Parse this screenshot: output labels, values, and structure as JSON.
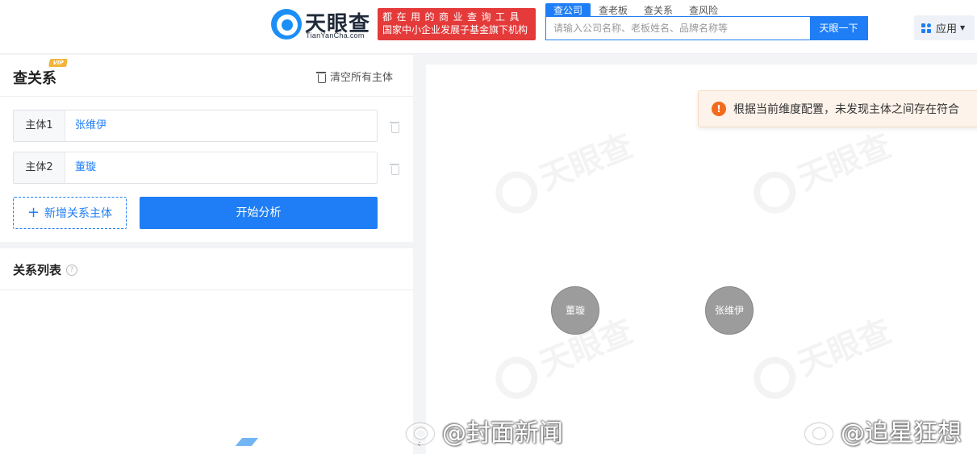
{
  "header": {
    "logo_text": "天眼查",
    "logo_sub": "TianYanCha.com",
    "slogan_line1": "都在用的商业查询工具",
    "slogan_line2": "国家中小企业发展子基金旗下机构",
    "search_tabs": [
      {
        "label": "查公司",
        "active": true
      },
      {
        "label": "查老板",
        "active": false
      },
      {
        "label": "查关系",
        "active": false
      },
      {
        "label": "查风险",
        "active": false
      }
    ],
    "search_placeholder": "请输入公司名称、老板姓名、品牌名称等",
    "search_button": "天眼一下",
    "apps_label": "应用",
    "accent_color": "#1f7ef5",
    "slogan_color": "#e43a3a"
  },
  "left_panel": {
    "title": "查关系",
    "vip_badge": "VIP",
    "clear_all": "清空所有主体",
    "entities": [
      {
        "label": "主体1",
        "value": "张维伊"
      },
      {
        "label": "主体2",
        "value": "董璇"
      }
    ],
    "add_button": "新增关系主体",
    "start_button": "开始分析"
  },
  "list_panel": {
    "title": "关系列表",
    "help_icon": "?"
  },
  "canvas": {
    "watermark_text": "天眼查",
    "alert_text": "根据当前维度配置，未发现主体之间存在符合",
    "nodes": [
      {
        "label": "董璇"
      },
      {
        "label": "张维伊"
      }
    ],
    "node_color": "#9c9c9c",
    "alert_icon_color": "#f26b1d"
  },
  "overlay": {
    "weibo_1": "@封面新闻",
    "weibo_2": "@追星狂想"
  }
}
